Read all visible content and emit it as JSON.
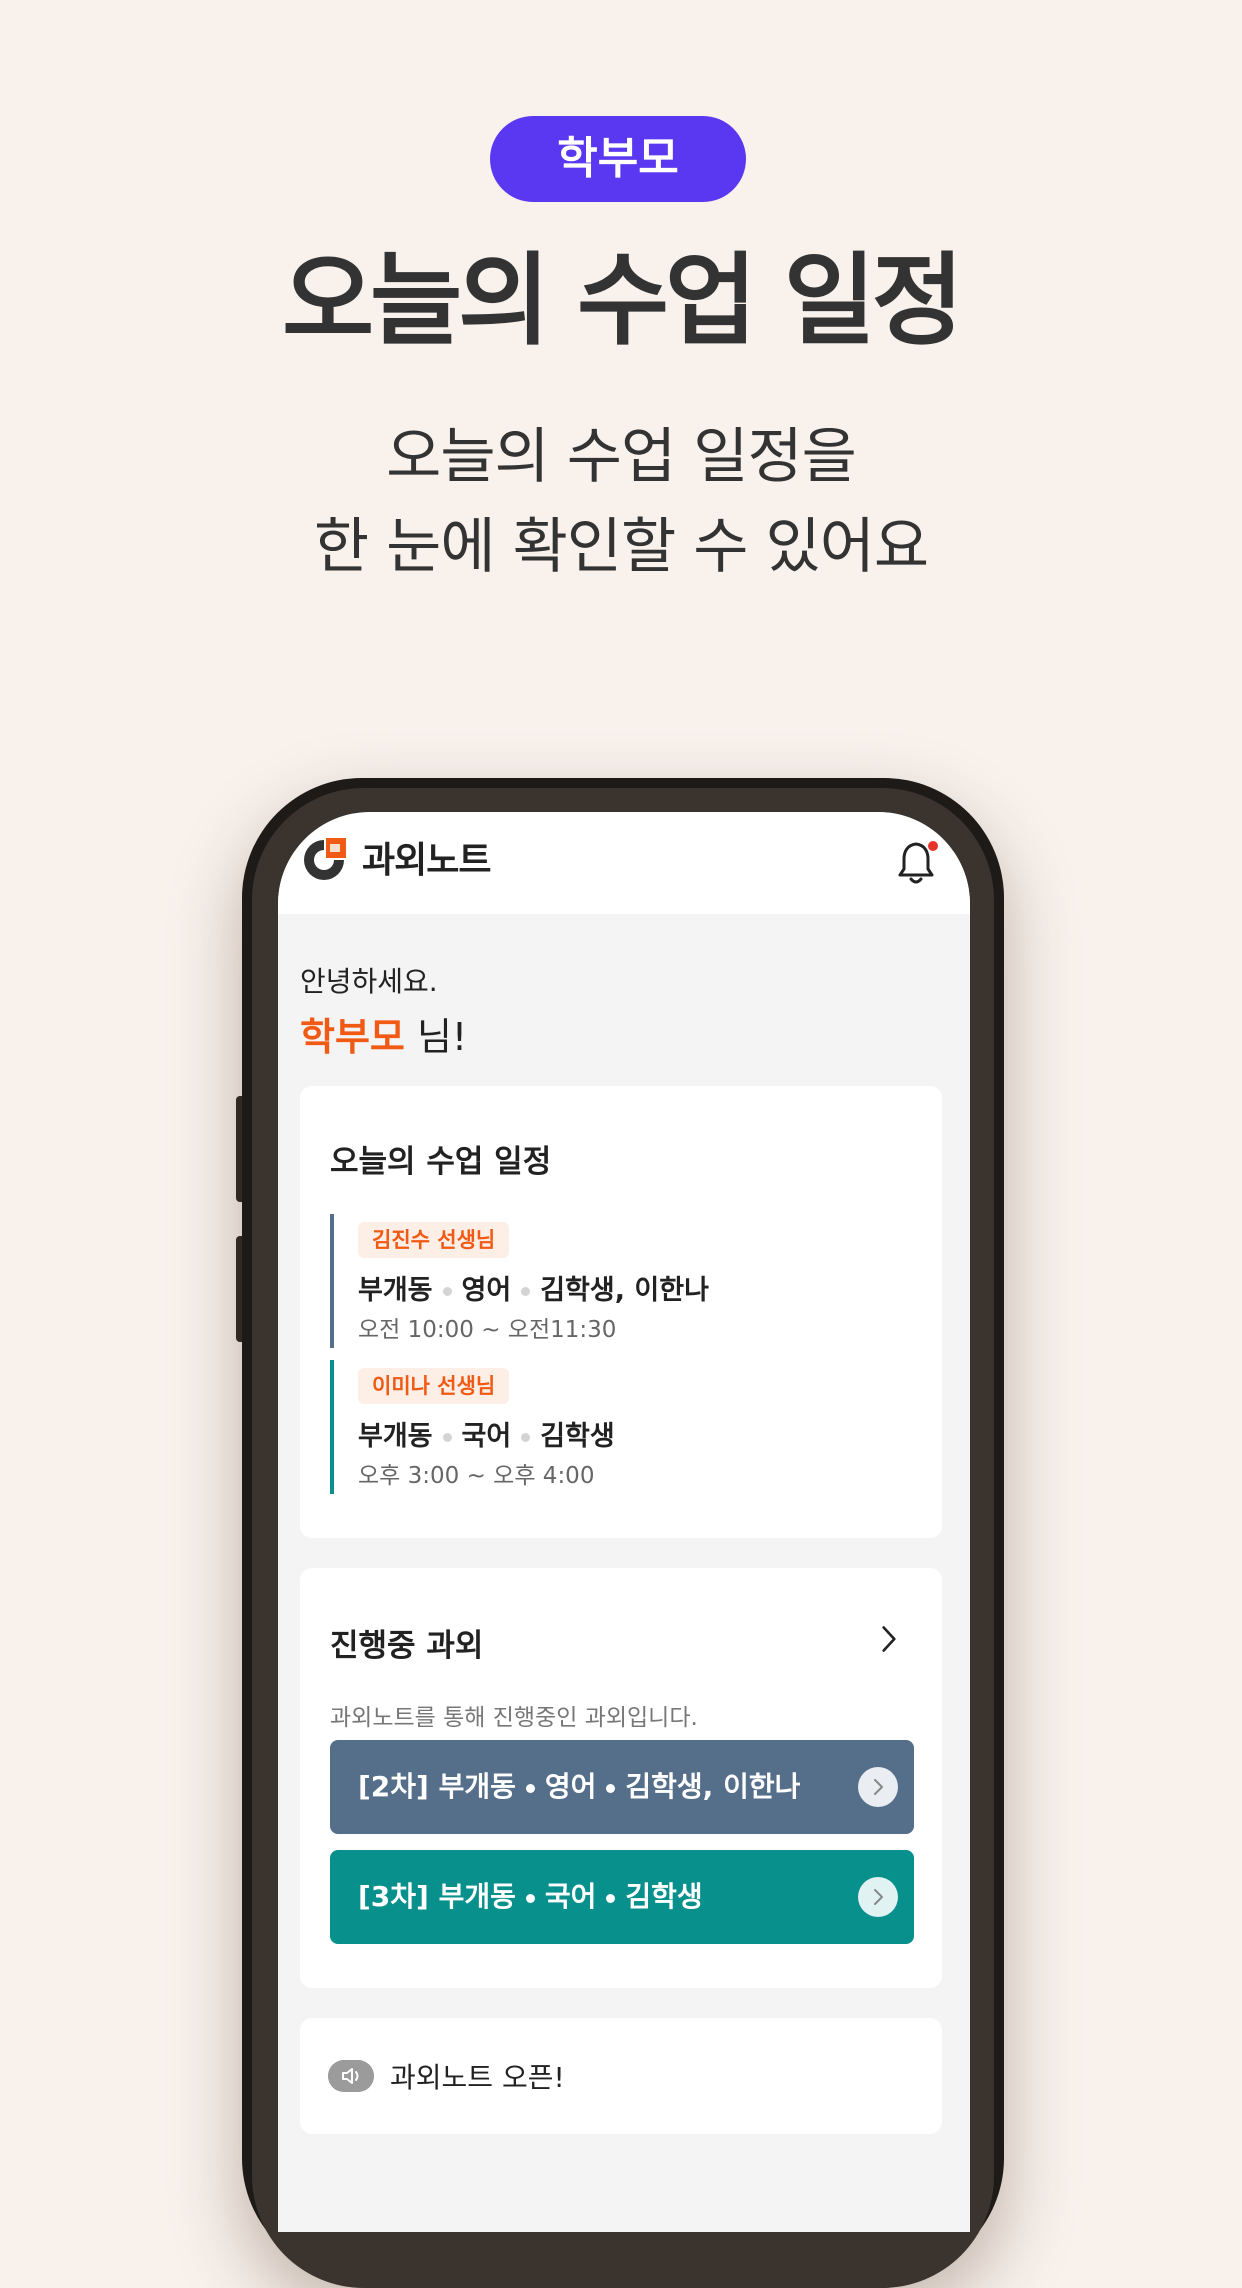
{
  "hero": {
    "role_badge": "학부모",
    "title": "오늘의 수업 일정",
    "subtitle_lines": [
      "오늘의 수업 일정을",
      "한 눈에 확인할 수 있어요"
    ]
  },
  "app": {
    "logo_text": "과외노트",
    "notification_dot": true,
    "greeting": "안녕하세요.",
    "user_name": "학부모",
    "user_suffix": " 님!",
    "today_card": {
      "title": "오늘의 수업 일정",
      "items": [
        {
          "teacher": "김진수 선생님",
          "location": "부개동",
          "subject": "영어",
          "students": "김학생, 이한나",
          "time": "오전 10:00 ~ 오전11:30",
          "bar_color": "#546e8c"
        },
        {
          "teacher": "이미나 선생님",
          "location": "부개동",
          "subject": "국어",
          "students": "김학생",
          "time": "오후 3:00 ~ 오후 4:00",
          "bar_color": "#0b8f8c"
        }
      ]
    },
    "ongoing_card": {
      "title": "진행중 과외",
      "description": "과외노트를 통해 진행중인 과외입니다.",
      "lessons": [
        {
          "round": "[2차]",
          "location": "부개동",
          "subject": "영어",
          "students": "김학생, 이한나",
          "color": "#556e8a"
        },
        {
          "round": "[3차]",
          "location": "부개동",
          "subject": "국어",
          "students": "김학생",
          "color": "#07908c"
        }
      ]
    },
    "notice": {
      "text": "과외노트 오픈!"
    }
  },
  "colors": {
    "background": "#f8f1ec",
    "badge": "#5a37f0",
    "accent": "#f05a14"
  }
}
